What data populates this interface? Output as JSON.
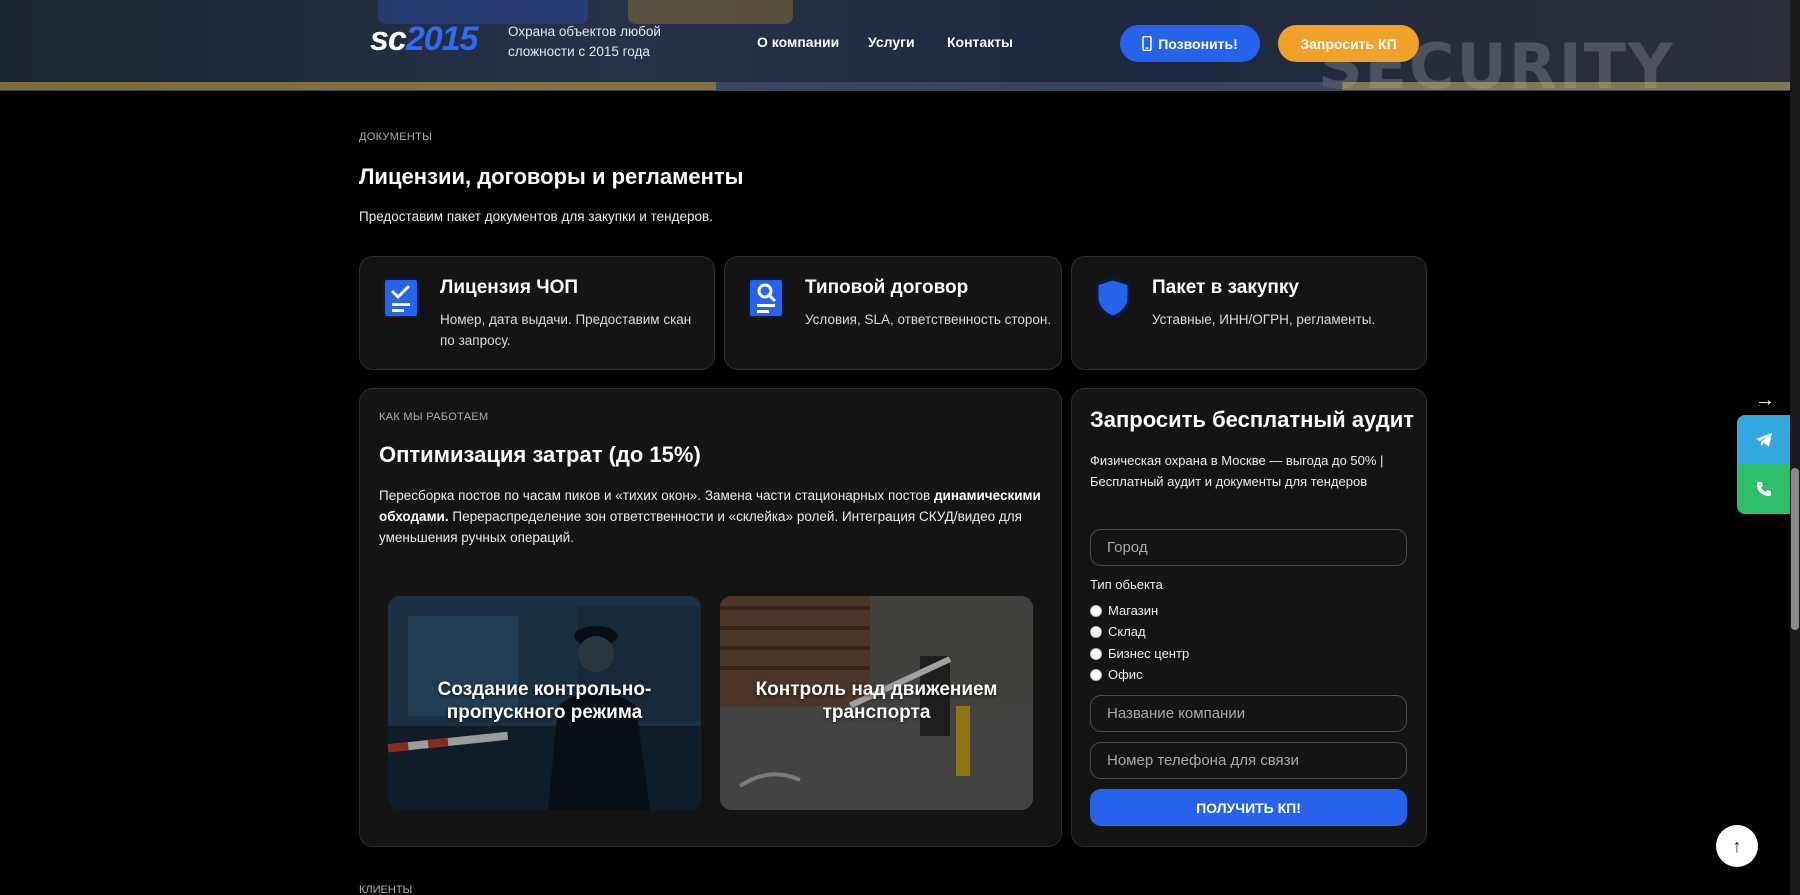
{
  "header": {
    "logo_sc": "sc",
    "logo_year": "2015",
    "tagline": "Охрана объектов любой сложности с 2015 года",
    "nav": [
      "О компании",
      "Услуги",
      "Контакты"
    ],
    "call_button": "Позвонить!",
    "kp_button": "Запросить КП",
    "ghost_text": "SECURITY"
  },
  "documents": {
    "eyebrow": "ДОКУМЕНТЫ",
    "title": "Лицензии, договоры и регламенты",
    "lead": "Предоставим пакет документов для закупки и тендеров.",
    "cards": [
      {
        "title": "Лицензия ЧОП",
        "text": "Номер, дата выдачи. Предоставим скан по запросу.",
        "icon": "license-check-icon"
      },
      {
        "title": "Типовой договор",
        "text": "Условия, SLA, ответственность сторон.",
        "icon": "contract-search-icon"
      },
      {
        "title": "Пакет в закупку",
        "text": "Уставные, ИНН/ОГРН, регламенты.",
        "icon": "shield-icon"
      }
    ]
  },
  "how_we_work": {
    "eyebrow": "КАК МЫ РАБОТАЕМ",
    "title": "Оптимизация затрат (до 15%)",
    "body_1": "Пересборка постов по часам пиков и «тихих окон». Замена части стационарных постов ",
    "body_bold": "динамическими обходами.",
    "body_2": " Перераспределение зон ответственности и «склейка» ролей. Интеграция СКУД/видео для уменьшения ручных операций.",
    "photos": [
      {
        "caption": "Создание контрольно-пропускного режима"
      },
      {
        "caption": "Контроль над движением транспорта"
      }
    ]
  },
  "audit_form": {
    "title": "Запросить бесплатный аудит",
    "description": "Физическая охрана в Москве — выгода до 50% | Бесплатный аудит и документы для тендеров",
    "city_placeholder": "Город",
    "object_type_label": "Тип обьекта",
    "object_types": [
      "Магазин",
      "Склад",
      "Бизнес центр",
      "Офис"
    ],
    "company_placeholder": "Название компании",
    "phone_placeholder": "Номер телефона для связи",
    "submit": "ПОЛУЧИТЬ КП!"
  },
  "clients_eyebrow": "КЛИЕНТЫ",
  "side": {
    "arrow": "→",
    "to_top": "↑"
  },
  "colors": {
    "accent_blue": "#2563eb",
    "accent_orange": "#f0a12a",
    "telegram": "#34a7de",
    "phone_green": "#2fbf6a",
    "card_bg": "#141414"
  }
}
